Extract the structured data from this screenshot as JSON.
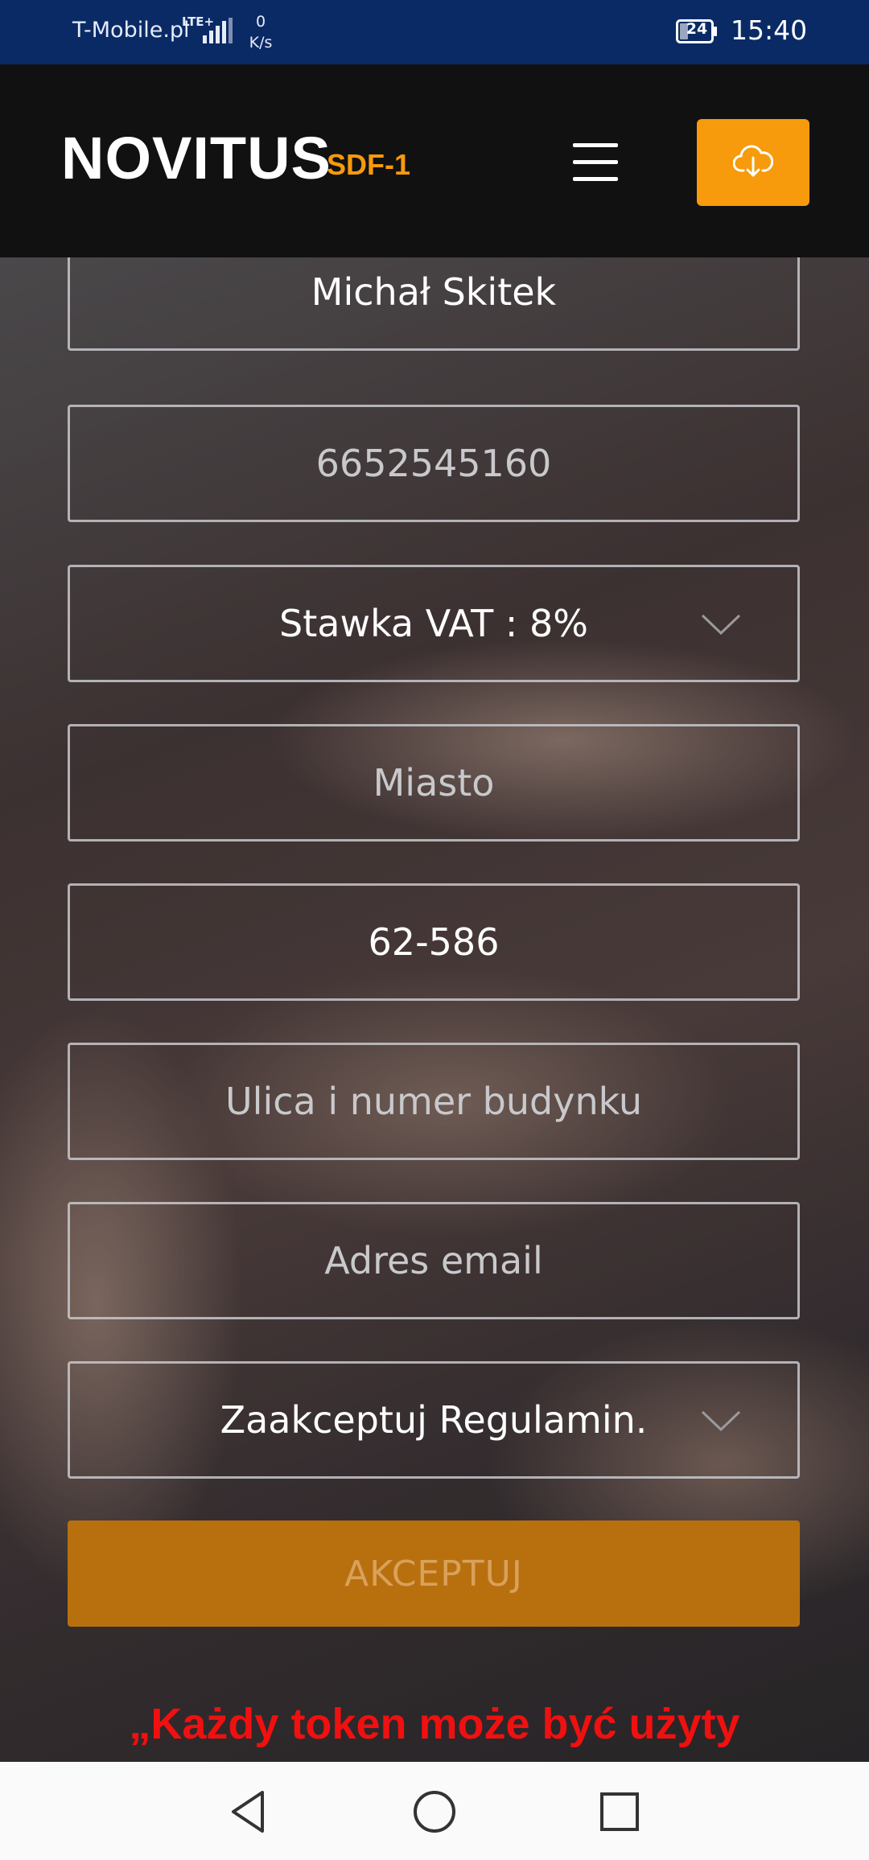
{
  "status_bar": {
    "carrier": "T-Mobile.pl",
    "network": "LTE+",
    "speed_value": "0",
    "speed_unit": "K/s",
    "battery": "24",
    "time": "15:40"
  },
  "header": {
    "brand": "NOVITUS",
    "model": "SDF-1",
    "menu_icon": "hamburger-icon",
    "cloud_icon": "cloud-download-icon",
    "accent_color": "#f79a0b"
  },
  "form": {
    "name_value": "Michał Skitek",
    "nip_value": "6652545160",
    "vat_select": "Stawka VAT : 8%",
    "city_placeholder": "Miasto",
    "postal_value": "62-586",
    "street_placeholder": "Ulica i numer budynku",
    "email_placeholder": "Adres email",
    "terms_select": "Zaakceptuj Regulamin.",
    "accept_label": "AKCEPTUJ"
  },
  "notice": "„Każdy token może być użyty"
}
